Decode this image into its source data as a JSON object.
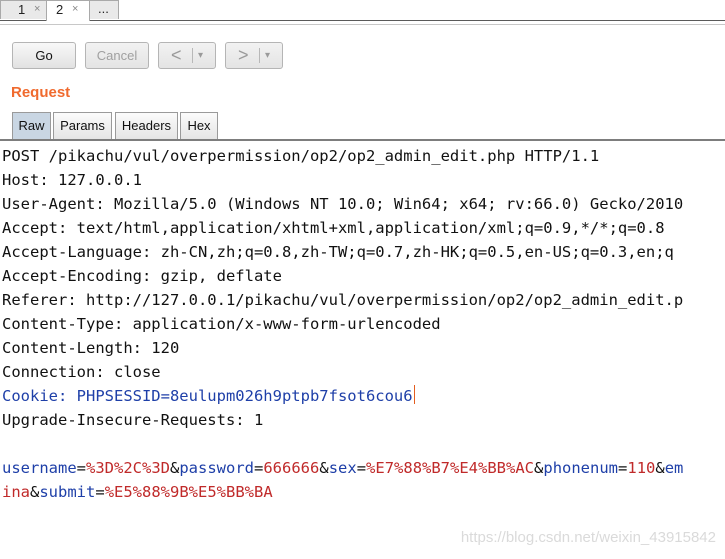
{
  "top_tabs": [
    {
      "label": "1",
      "close": "×"
    },
    {
      "label": "2",
      "close": "×"
    },
    {
      "label": "..."
    }
  ],
  "toolbar": {
    "go": "Go",
    "cancel": "Cancel",
    "back_arrow": "<",
    "forward_arrow": ">",
    "dropdown": "▾"
  },
  "section_title": "Request",
  "editor_tabs": [
    "Raw",
    "Params",
    "Headers",
    "Hex"
  ],
  "request": {
    "l1": "POST /pikachu/vul/overpermission/op2/op2_admin_edit.php HTTP/1.1",
    "l2": "Host: 127.0.0.1",
    "l3": "User-Agent: Mozilla/5.0 (Windows NT 10.0; Win64; x64; rv:66.0) Gecko/2010",
    "l4": "Accept: text/html,application/xhtml+xml,application/xml;q=0.9,*/*;q=0.8",
    "l5": "Accept-Language: zh-CN,zh;q=0.8,zh-TW;q=0.7,zh-HK;q=0.5,en-US;q=0.3,en;q",
    "l6": "Accept-Encoding: gzip, deflate",
    "l7": "Referer: http://127.0.0.1/pikachu/vul/overpermission/op2/op2_admin_edit.p",
    "l8": "Content-Type: application/x-www-form-urlencoded",
    "l9": "Content-Length: 120",
    "l10": "Connection: close",
    "l11": "Cookie: PHPSESSID=8eulupm026h9ptpb7fsot6cou6",
    "l12": "Upgrade-Insecure-Requests: 1",
    "body1": [
      {
        "t": "username",
        "c": "blue"
      },
      {
        "t": "=",
        "c": "plain"
      },
      {
        "t": "%3D%2C%3D",
        "c": "red"
      },
      {
        "t": "&",
        "c": "plain"
      },
      {
        "t": "password",
        "c": "blue"
      },
      {
        "t": "=",
        "c": "plain"
      },
      {
        "t": "666666",
        "c": "red"
      },
      {
        "t": "&",
        "c": "plain"
      },
      {
        "t": "sex",
        "c": "blue"
      },
      {
        "t": "=",
        "c": "plain"
      },
      {
        "t": "%E7%88%B7%E4%BB%AC",
        "c": "red"
      },
      {
        "t": "&",
        "c": "plain"
      },
      {
        "t": "phonenum",
        "c": "blue"
      },
      {
        "t": "=",
        "c": "plain"
      },
      {
        "t": "110",
        "c": "red"
      },
      {
        "t": "&",
        "c": "plain"
      },
      {
        "t": "em",
        "c": "blue"
      }
    ],
    "body2": [
      {
        "t": "ina",
        "c": "red"
      },
      {
        "t": "&",
        "c": "plain"
      },
      {
        "t": "submit",
        "c": "blue"
      },
      {
        "t": "=",
        "c": "plain"
      },
      {
        "t": "%E5%88%9B%E5%BB%BA",
        "c": "red"
      }
    ]
  },
  "watermark": "https://blog.csdn.net/weixin_43915842"
}
